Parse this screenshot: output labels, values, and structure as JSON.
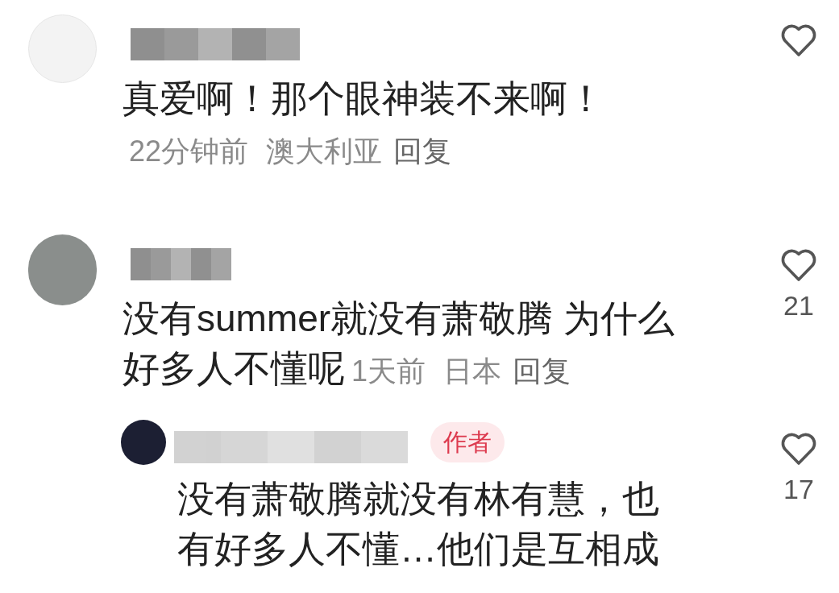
{
  "comments": [
    {
      "kind": "light",
      "lines": [
        "真爱啊！那个眼神装不来啊！"
      ],
      "time": "22分钟前",
      "location": "澳大利亚",
      "reply_label": "回复",
      "liked": false
    },
    {
      "kind": "photo",
      "lines": [
        "没有summer就没有萧敬腾 为什么",
        "好多人不懂呢"
      ],
      "time": "1天前",
      "location": "日本",
      "reply_label": "回复",
      "liked": false,
      "likes": "21",
      "replies": [
        {
          "kind": "dark",
          "badge": "作者",
          "lines": [
            "没有萧敬腾就没有林有慧，也",
            "有好多人不懂…他们是互相成"
          ],
          "liked": false,
          "likes": "17"
        }
      ]
    }
  ]
}
